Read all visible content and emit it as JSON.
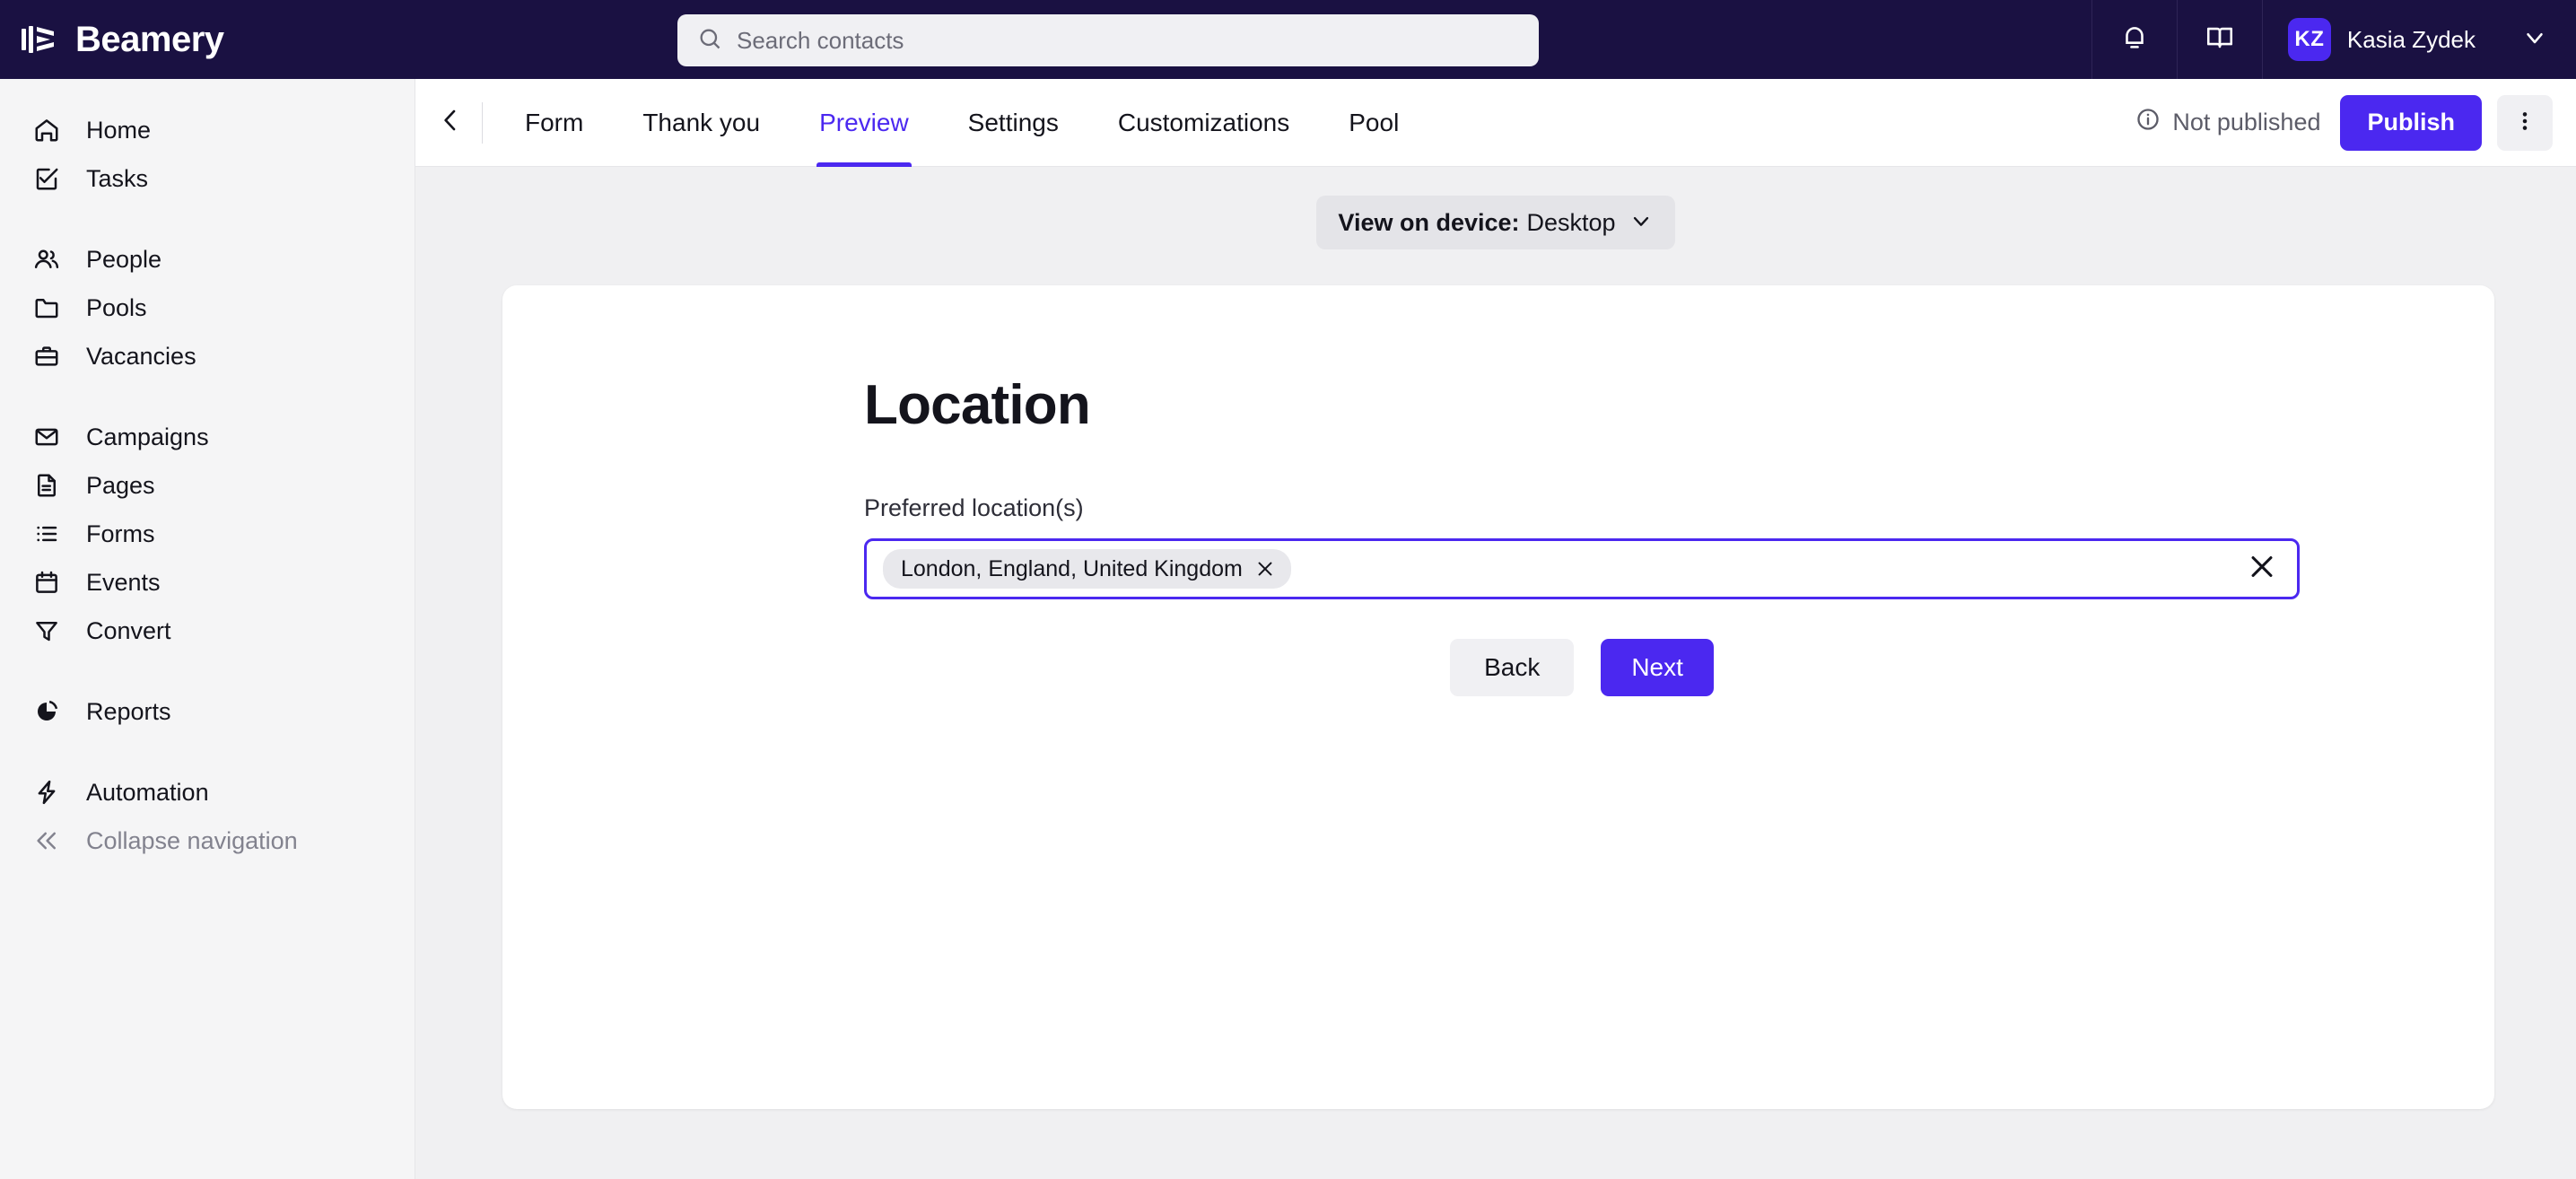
{
  "brand": {
    "name": "Beamery",
    "logo_icon": "beamery-logo-icon"
  },
  "search": {
    "placeholder": "Search contacts",
    "value": "",
    "icon": "search-icon"
  },
  "topbar": {
    "notifications_icon": "bell-icon",
    "knowledge_icon": "book-icon",
    "user_initials": "KZ",
    "user_name": "Kasia Zydek",
    "user_caret_icon": "chevron-down-icon",
    "avatar_color": "#4b28f0"
  },
  "sidebar": {
    "items": [
      {
        "label": "Home",
        "icon": "home-icon"
      },
      {
        "label": "Tasks",
        "icon": "task-check-icon"
      },
      {
        "label": "People",
        "icon": "people-icon"
      },
      {
        "label": "Pools",
        "icon": "folder-icon"
      },
      {
        "label": "Vacancies",
        "icon": "briefcase-icon"
      },
      {
        "label": "Campaigns",
        "icon": "envelope-icon"
      },
      {
        "label": "Pages",
        "icon": "document-icon"
      },
      {
        "label": "Forms",
        "icon": "list-icon"
      },
      {
        "label": "Events",
        "icon": "calendar-icon"
      },
      {
        "label": "Convert",
        "icon": "funnel-icon"
      },
      {
        "label": "Reports",
        "icon": "pie-chart-icon"
      },
      {
        "label": "Automation",
        "icon": "lightning-bolt-icon"
      }
    ],
    "collapse": {
      "label": "Collapse navigation",
      "icon": "double-chevron-left-icon"
    }
  },
  "tabbar": {
    "back_icon": "chevron-left-icon",
    "tabs": [
      {
        "label": "Form",
        "active": false
      },
      {
        "label": "Thank you",
        "active": false
      },
      {
        "label": "Preview",
        "active": true
      },
      {
        "label": "Settings",
        "active": false
      },
      {
        "label": "Customizations",
        "active": false
      },
      {
        "label": "Pool",
        "active": false
      }
    ],
    "status": {
      "label": "Not published",
      "icon": "info-icon"
    },
    "publish_label": "Publish",
    "kebab_icon": "more-vertical-icon",
    "accent_color": "#4b28f0"
  },
  "device": {
    "label": "View on device:",
    "value": "Desktop",
    "caret_icon": "chevron-down-icon"
  },
  "form": {
    "title": "Location",
    "field_label": "Preferred location(s)",
    "chips": [
      {
        "label": "London, England, United Kingdom",
        "remove_icon": "close-icon"
      }
    ],
    "clear_icon": "close-icon",
    "input_value": "",
    "back_label": "Back",
    "next_label": "Next"
  }
}
